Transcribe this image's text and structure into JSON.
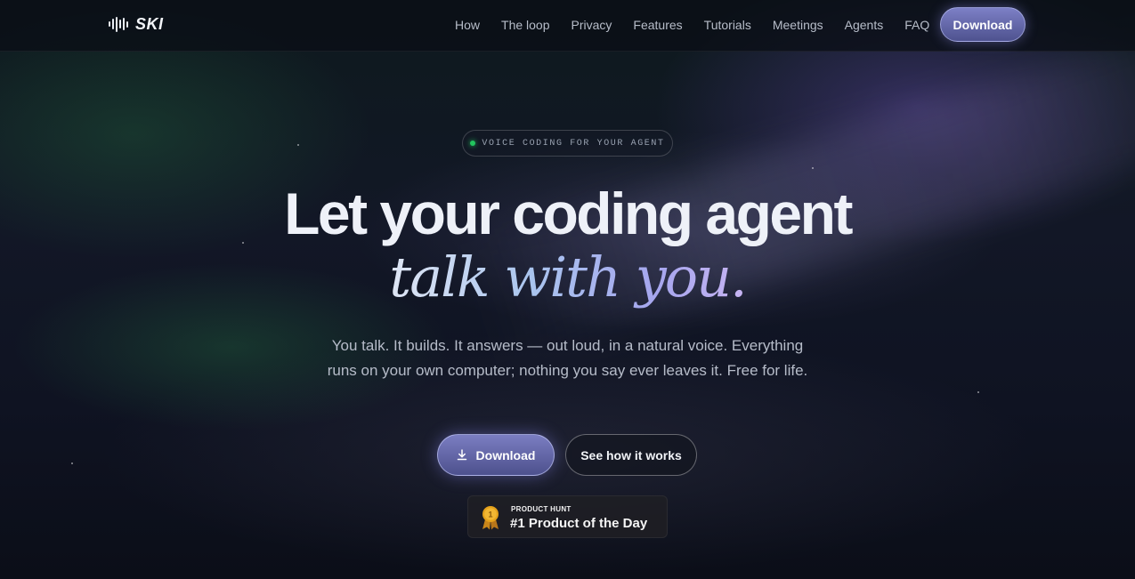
{
  "brand": {
    "name": "SKI"
  },
  "nav": {
    "links": [
      "How",
      "The loop",
      "Privacy",
      "Features",
      "Tutorials",
      "Meetings",
      "Agents",
      "FAQ"
    ],
    "download_label": "Download"
  },
  "hero": {
    "badge": "VOICE CODING FOR YOUR AGENT",
    "headline_line1": "Let your coding agent",
    "headline_line2": "talk with you.",
    "subtitle": "You talk. It builds. It answers — out loud, in a natural voice. Everything runs on your own computer; nothing you say ever leaves it. Free for life.",
    "primary_cta": "Download",
    "secondary_cta": "See how it works"
  },
  "product_hunt": {
    "label": "PRODUCT HUNT",
    "title": "#1 Product of the Day",
    "rank": "1"
  },
  "colors": {
    "accent": "#6d70b5",
    "status_dot": "#22c55e",
    "medal": "#e6a21b"
  },
  "icons": [
    "soundwave-icon",
    "download-icon",
    "medal-icon"
  ]
}
